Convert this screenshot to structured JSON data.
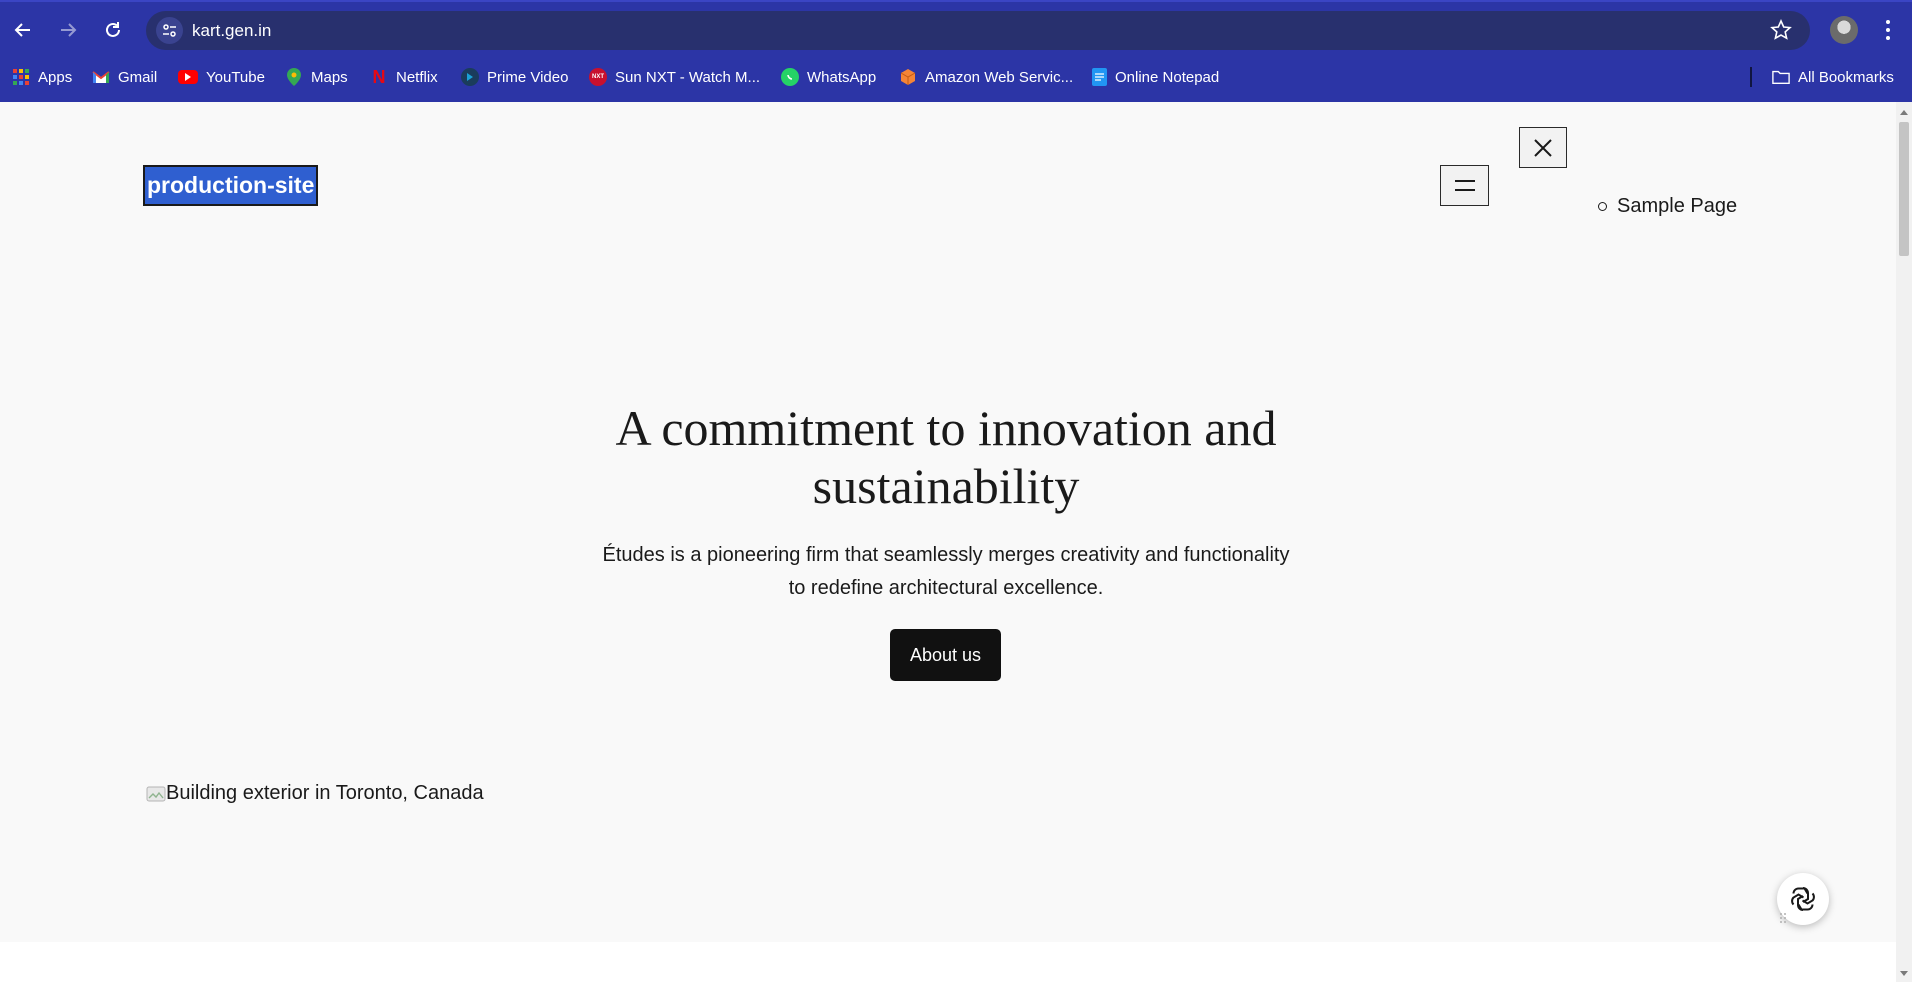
{
  "browser": {
    "url": "kart.gen.in",
    "bookmarks": [
      {
        "label": "Apps",
        "icon": "apps-grid-icon",
        "color": "#e94235"
      },
      {
        "label": "Gmail",
        "icon": "gmail-icon",
        "color": "#ea4335"
      },
      {
        "label": "YouTube",
        "icon": "youtube-icon",
        "color": "#ff0000"
      },
      {
        "label": "Maps",
        "icon": "maps-pin-icon",
        "color": "#34a853"
      },
      {
        "label": "Netflix",
        "icon": "netflix-icon",
        "color": "#e50914"
      },
      {
        "label": "Prime Video",
        "icon": "prime-video-icon",
        "color": "#1aa1d6"
      },
      {
        "label": "Sun NXT - Watch M...",
        "icon": "sun-nxt-icon",
        "color": "#c8102e"
      },
      {
        "label": "WhatsApp",
        "icon": "whatsapp-icon",
        "color": "#25d366"
      },
      {
        "label": "Amazon Web Servic...",
        "icon": "aws-box-icon",
        "color": "#f58536"
      },
      {
        "label": "Online Notepad",
        "icon": "notepad-icon",
        "color": "#2196f3"
      }
    ],
    "all_bookmarks": "All Bookmarks"
  },
  "site": {
    "title": "production-site",
    "nav_items": [
      "Sample Page"
    ]
  },
  "hero": {
    "title": "A commitment to innovation and sustainability",
    "text": "Études is a pioneering firm that seamlessly merges creativity and functionality to redefine architectural excellence.",
    "button": "About us"
  },
  "image": {
    "alt": "Building exterior in Toronto, Canada"
  },
  "colors": {
    "chrome": "#2c35a6",
    "omnibox": "#28306e",
    "page_bg": "#f9f9f9",
    "selection": "#2f5fd0",
    "button_bg": "#111111"
  }
}
